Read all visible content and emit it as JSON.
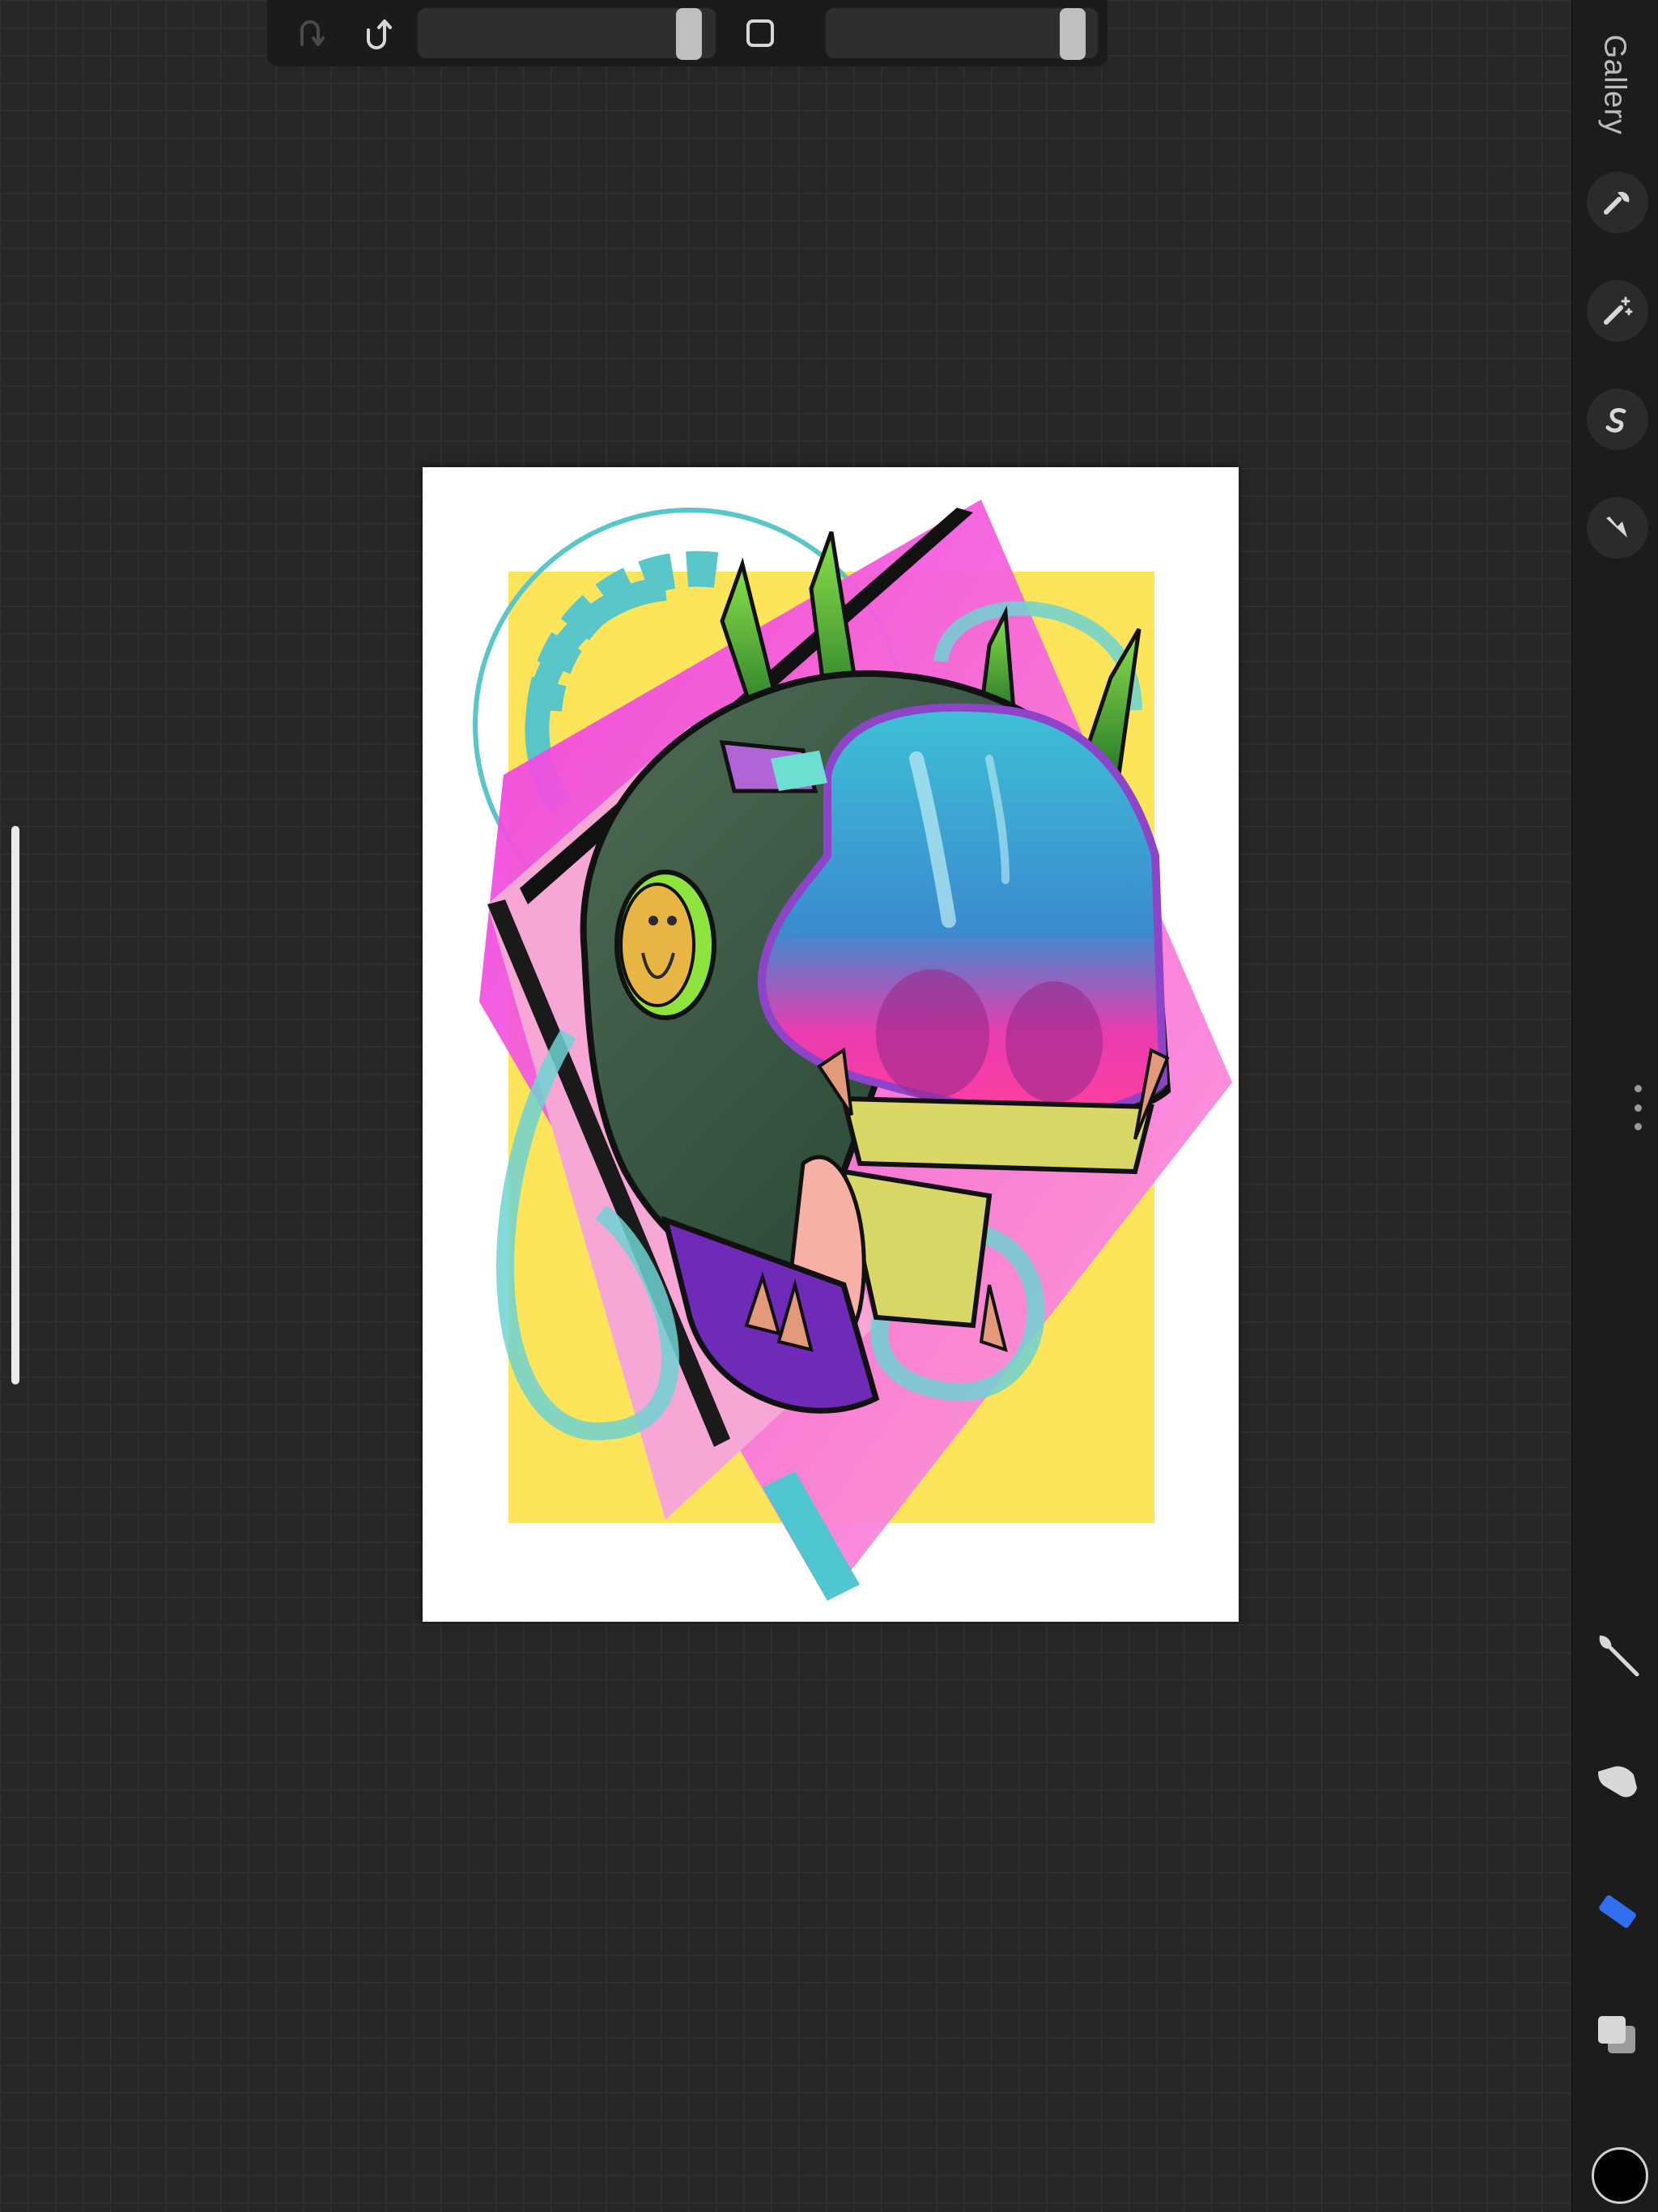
{
  "toolbar": {
    "redo_icon": "redo-icon",
    "undo_icon": "undo-icon",
    "brush_size": 0.95,
    "brush_opacity": 0.95,
    "modifier_icon": "square-modifier-icon"
  },
  "sidebar": {
    "gallery_label": "Gallery",
    "actions": [
      {
        "name": "actions",
        "icon": "wrench-icon"
      },
      {
        "name": "adjustments",
        "icon": "magic-wand-icon"
      },
      {
        "name": "selection",
        "icon": "selection-s-icon"
      },
      {
        "name": "transform",
        "icon": "arrow-cursor-icon"
      }
    ],
    "tools": [
      {
        "name": "paint",
        "icon": "brush-icon",
        "active": false
      },
      {
        "name": "smudge",
        "icon": "smudge-finger-icon",
        "active": false
      },
      {
        "name": "erase",
        "icon": "eraser-icon",
        "active": true
      },
      {
        "name": "layers",
        "icon": "layers-icon",
        "active": false
      }
    ],
    "active_color": "#000000",
    "accent_color": "#2f6ff0"
  },
  "canvas": {
    "artwork": "neon-skull-helmet-illustration"
  }
}
